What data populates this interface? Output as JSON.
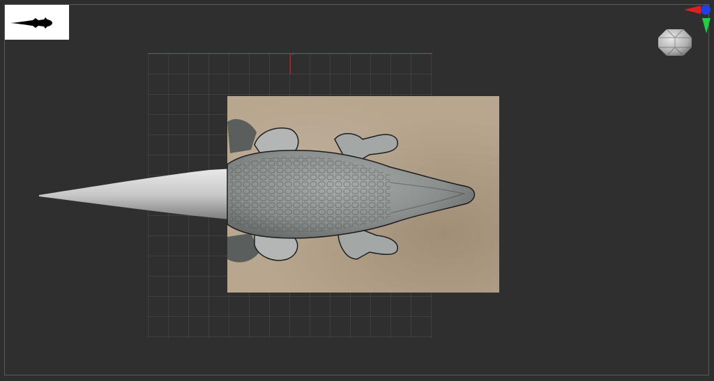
{
  "app": {
    "window_kind": "3d-viewport"
  },
  "viewport": {
    "background_color": "#2e2e2e",
    "grid_color": "#4a4a4a",
    "reference_plane_color": "#b8a68f"
  },
  "scene": {
    "model_icon": "crocodile-silhouette-icon",
    "gizmo_icon": "axis-gizmo-icon",
    "navigation_icon": "view-cube-sphere-icon",
    "axis_colors": {
      "x": "#e02020",
      "y": "#20d040",
      "z": "#2040e0"
    }
  }
}
